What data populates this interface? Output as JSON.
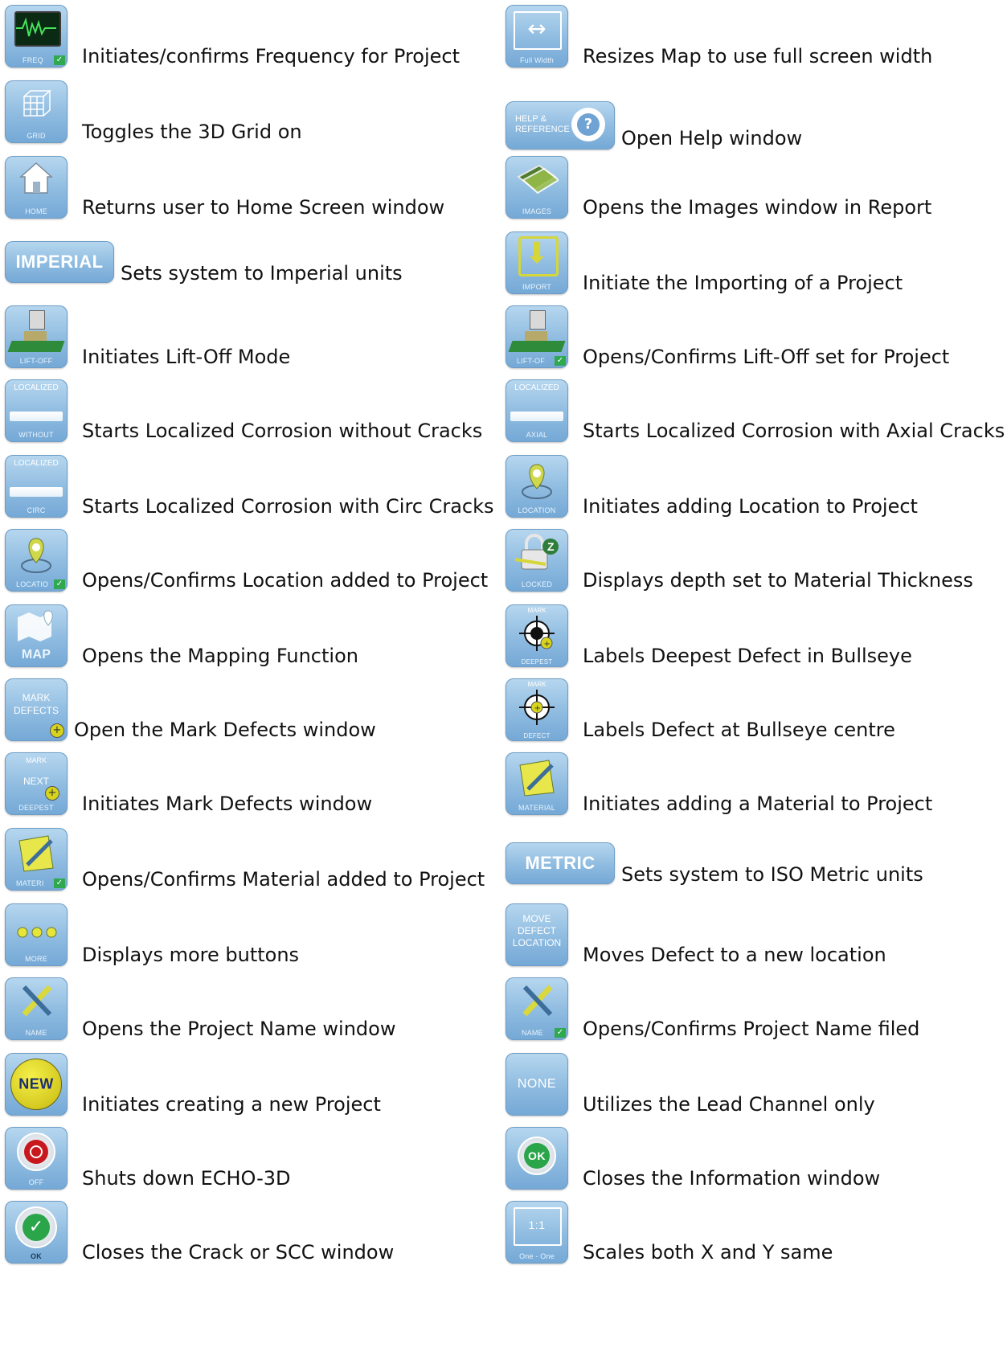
{
  "left": [
    {
      "text": "Initiates/confirms Frequency for Project",
      "icon": "freq-icon",
      "caption": "FREQ"
    },
    {
      "text": "Toggles the 3D Grid on",
      "icon": "grid-icon",
      "caption": "GRID"
    },
    {
      "text": "Returns user to Home Screen window",
      "icon": "home-icon",
      "caption": "HOME"
    },
    {
      "text": "Sets system to Imperial units",
      "icon": "imperial-icon",
      "caption": "IMPERIAL"
    },
    {
      "text": "Initiates Lift-Off Mode",
      "icon": "lift-off-icon",
      "caption": "LIFT-OFF"
    },
    {
      "text": "Starts Localized Corrosion without Cracks",
      "icon": "localized-without-icon",
      "caption_top": "LOCALIZED",
      "caption": "WITHOUT"
    },
    {
      "text": "Starts Localized Corrosion with Circ Cracks",
      "icon": "localized-circ-icon",
      "caption_top": "LOCALIZED",
      "caption": "CIRC"
    },
    {
      "text": "Opens/Confirms Location added to Project",
      "icon": "location-confirm-icon",
      "caption": "LOCATIO"
    },
    {
      "text": "Opens the Mapping Function",
      "icon": "map-icon",
      "caption": "MAP"
    },
    {
      "text": "Open the Mark Defects window",
      "icon": "mark-defects-icon",
      "caption_top": "MARK",
      "caption": "DEFECTS"
    },
    {
      "text": "Initiates Mark Defects window",
      "icon": "mark-next-deepest-icon",
      "caption_top": "MARK",
      "caption_mid": "NEXT",
      "caption": "DEEPEST"
    },
    {
      "text": "Opens/Confirms Material added to Project",
      "icon": "material-confirm-icon",
      "caption": "MATERI"
    },
    {
      "text": "Displays more buttons",
      "icon": "more-icon",
      "caption": "MORE"
    },
    {
      "text": "Opens the Project Name window",
      "icon": "name-icon",
      "caption": "NAME"
    },
    {
      "text": "Initiates creating a new Project",
      "icon": "new-icon",
      "caption": "NEW"
    },
    {
      "text": "Shuts down ECHO-3D",
      "icon": "power-off-icon",
      "caption": "OFF"
    },
    {
      "text": "Closes the Crack or SCC window",
      "icon": "ok-check-icon",
      "caption": "OK"
    }
  ],
  "right": [
    {
      "text": "Resizes Map to use full screen width",
      "icon": "full-width-icon",
      "caption": "Full Width"
    },
    {
      "text": "Open Help window",
      "icon": "help-icon",
      "caption_top": "HELP &",
      "caption": "REFERENCE",
      "glyph": "?"
    },
    {
      "text": "Opens the Images window in Report",
      "icon": "images-icon",
      "caption": "IMAGES"
    },
    {
      "text": "Initiate the Importing of a Project",
      "icon": "import-icon",
      "caption": "IMPORT"
    },
    {
      "text": "Opens/Confirms Lift-Off set for Project",
      "icon": "lift-off-confirm-icon",
      "caption": "LIFT-OF"
    },
    {
      "text": "Starts Localized Corrosion with Axial Cracks",
      "icon": "localized-axial-icon",
      "caption_top": "LOCALIZED",
      "caption": "AXIAL"
    },
    {
      "text": "Initiates adding Location to Project",
      "icon": "location-icon",
      "caption": "LOCATION"
    },
    {
      "text": "Displays depth set to Material Thickness",
      "icon": "locked-icon",
      "caption": "LOCKED"
    },
    {
      "text": "Labels Deepest Defect in Bullseye",
      "icon": "mark-deepest-icon",
      "caption_top": "MARK",
      "caption": "DEEPEST"
    },
    {
      "text": "Labels Defect at Bullseye centre",
      "icon": "mark-defect-icon",
      "caption_top": "MARK",
      "caption": "DEFECT"
    },
    {
      "text": "Initiates adding a Material to Project",
      "icon": "material-icon",
      "caption": "MATERIAL"
    },
    {
      "text": "Sets system to ISO Metric units",
      "icon": "metric-icon",
      "caption": "METRIC"
    },
    {
      "text": "Moves Defect to a new location",
      "icon": "move-defect-icon",
      "caption_top": "MOVE",
      "caption_mid": "DEFECT",
      "caption": "LOCATION"
    },
    {
      "text": "Opens/Confirms Project Name filed",
      "icon": "name-confirm-icon",
      "caption": "NAME"
    },
    {
      "text": "Utilizes the Lead Channel only",
      "icon": "none-icon",
      "caption": "NONE"
    },
    {
      "text": "Closes the Information window",
      "icon": "ok-icon",
      "caption": "OK"
    },
    {
      "text": "Scales both X and Y same",
      "icon": "one-to-one-icon",
      "caption_top": "1:1",
      "caption": "One - One"
    }
  ]
}
